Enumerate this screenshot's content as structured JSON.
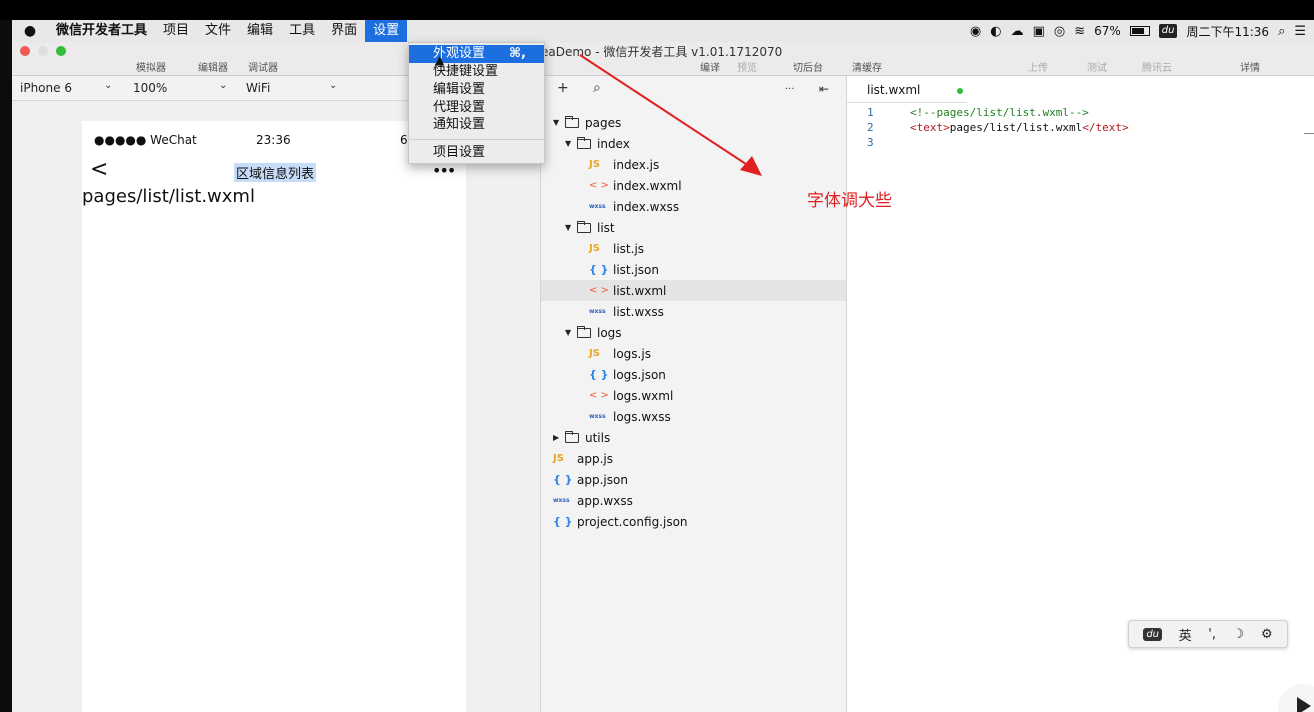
{
  "menubar": {
    "apple": "",
    "app_name": "微信开发者工具",
    "items": [
      "项目",
      "文件",
      "编辑",
      "工具",
      "界面",
      "设置"
    ],
    "status": {
      "battery_pct": "67%",
      "du": "du",
      "clock": "周二下午11:36"
    }
  },
  "window": {
    "title": "eaDemo - 微信开发者工具 v1.01.1712070",
    "tabs": [
      "模拟器",
      "编辑器",
      "调试器"
    ],
    "right_actions": [
      "编译",
      "预览",
      "切后台",
      "清缓存",
      "上传",
      "测试",
      "腾讯云",
      "详情"
    ]
  },
  "settings_menu": {
    "items": [
      {
        "label": "外观设置",
        "shortcut": "⌘,"
      },
      {
        "label": "快捷键设置"
      },
      {
        "label": "编辑设置"
      },
      {
        "label": "代理设置"
      },
      {
        "label": "通知设置"
      },
      {
        "label": "项目设置"
      }
    ]
  },
  "simulator": {
    "device": "iPhone 6",
    "zoom": "100%",
    "network": "WiFi",
    "status_carrier": "●●●●● WeChat",
    "status_time": "23:36",
    "status_battery": "6",
    "nav_back": "<",
    "nav_title": "区域信息列表",
    "nav_more": "•••",
    "page_text": "pages/list/list.wxml"
  },
  "explorer": {
    "toolbar": {
      "add": "+",
      "search": "⌕",
      "more": "···",
      "layout": "⇤"
    },
    "tree": [
      {
        "kind": "folder",
        "open": true,
        "name": "pages",
        "depth": 0
      },
      {
        "kind": "folder",
        "open": true,
        "name": "index",
        "depth": 1
      },
      {
        "kind": "file",
        "type": "js",
        "icon": "JS",
        "name": "index.js",
        "depth": 2
      },
      {
        "kind": "file",
        "type": "wxml",
        "icon": "< >",
        "name": "index.wxml",
        "depth": 2
      },
      {
        "kind": "file",
        "type": "wxss",
        "icon": "wxss",
        "name": "index.wxss",
        "depth": 2
      },
      {
        "kind": "folder",
        "open": true,
        "name": "list",
        "depth": 1
      },
      {
        "kind": "file",
        "type": "js",
        "icon": "JS",
        "name": "list.js",
        "depth": 2
      },
      {
        "kind": "file",
        "type": "json",
        "icon": "{ }",
        "name": "list.json",
        "depth": 2
      },
      {
        "kind": "file",
        "type": "wxml",
        "icon": "< >",
        "name": "list.wxml",
        "depth": 2,
        "selected": true
      },
      {
        "kind": "file",
        "type": "wxss",
        "icon": "wxss",
        "name": "list.wxss",
        "depth": 2
      },
      {
        "kind": "folder",
        "open": true,
        "name": "logs",
        "depth": 1
      },
      {
        "kind": "file",
        "type": "js",
        "icon": "JS",
        "name": "logs.js",
        "depth": 2
      },
      {
        "kind": "file",
        "type": "json",
        "icon": "{ }",
        "name": "logs.json",
        "depth": 2
      },
      {
        "kind": "file",
        "type": "wxml",
        "icon": "< >",
        "name": "logs.wxml",
        "depth": 2
      },
      {
        "kind": "file",
        "type": "wxss",
        "icon": "wxss",
        "name": "logs.wxss",
        "depth": 2
      },
      {
        "kind": "folder",
        "open": false,
        "name": "utils",
        "depth": 0
      },
      {
        "kind": "file",
        "type": "js",
        "icon": "JS",
        "name": "app.js",
        "depth": 0
      },
      {
        "kind": "file",
        "type": "json",
        "icon": "{ }",
        "name": "app.json",
        "depth": 0
      },
      {
        "kind": "file",
        "type": "wxss",
        "icon": "wxss",
        "name": "app.wxss",
        "depth": 0
      },
      {
        "kind": "file",
        "type": "json",
        "icon": "{ }",
        "name": "project.config.json",
        "depth": 0
      }
    ]
  },
  "editor": {
    "tab_name": "list.wxml",
    "lines": [
      {
        "num": "1",
        "comment": "<!--pages/list/list.wxml-->"
      },
      {
        "num": "2",
        "open_tag": "<text>",
        "text": "pages/list/list.wxml",
        "close_tag": "</text>"
      },
      {
        "num": "3"
      }
    ]
  },
  "annotation": {
    "text": "字体调大些",
    "color": "#e02020"
  },
  "ime": {
    "du": "du",
    "lang": "英",
    "punct": "',",
    "moon": "☽",
    "gear": "⚙"
  },
  "colors": {
    "accent": "#1d6fe0",
    "js": "#e8a628",
    "json": "#2a84e6",
    "wxml": "#f05b2b",
    "wxss": "#2c63c0"
  }
}
